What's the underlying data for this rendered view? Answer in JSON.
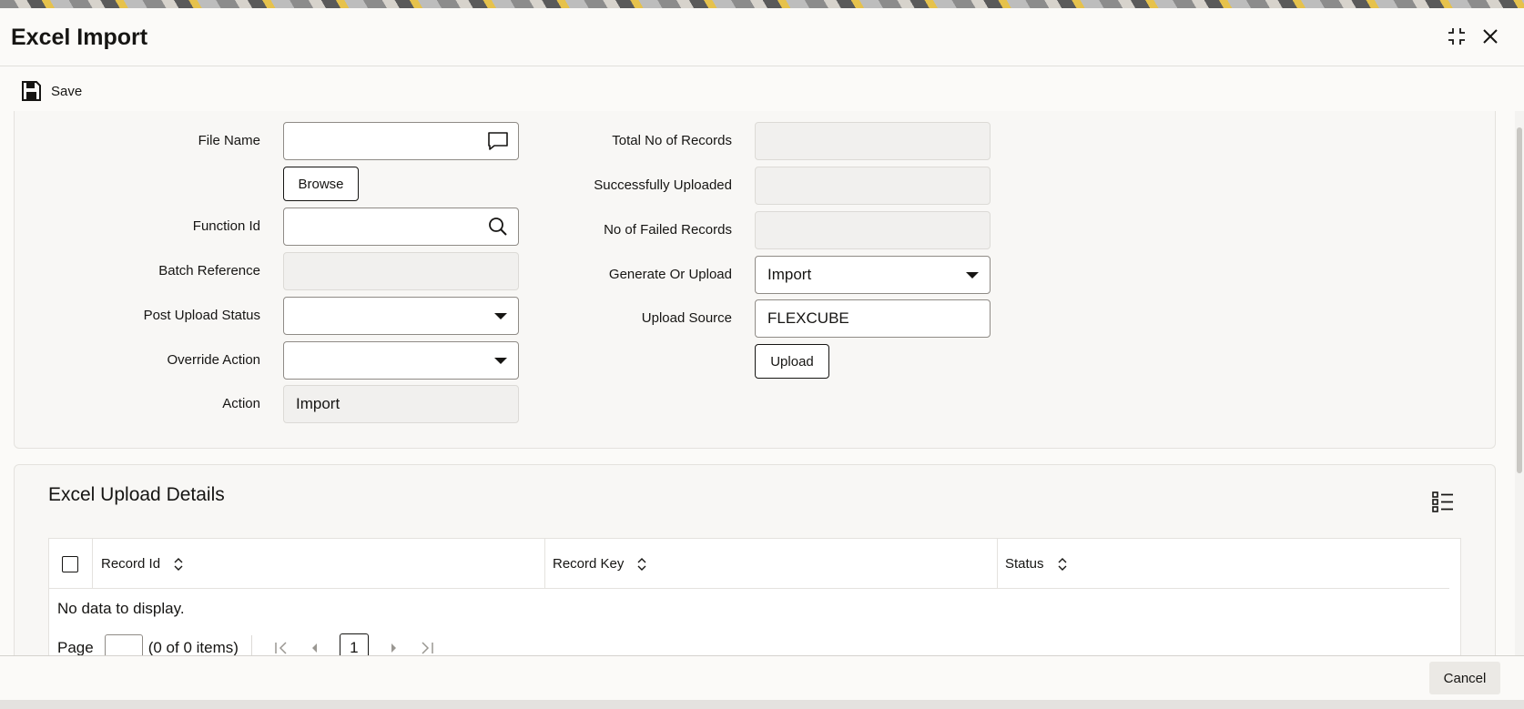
{
  "window": {
    "title": "Excel Import"
  },
  "toolbar": {
    "save_label": "Save"
  },
  "form": {
    "file_name": {
      "label": "File Name",
      "value": ""
    },
    "browse_label": "Browse",
    "function_id": {
      "label": "Function Id",
      "value": ""
    },
    "batch_reference": {
      "label": "Batch Reference",
      "value": ""
    },
    "post_upload_status": {
      "label": "Post Upload Status",
      "value": ""
    },
    "override_action": {
      "label": "Override Action",
      "value": ""
    },
    "action": {
      "label": "Action",
      "value": "Import"
    },
    "total_records": {
      "label": "Total No of Records",
      "value": ""
    },
    "successfully_uploaded": {
      "label": "Successfully Uploaded",
      "value": ""
    },
    "failed_records": {
      "label": "No of Failed Records",
      "value": ""
    },
    "generate_or_upload": {
      "label": "Generate Or Upload",
      "value": "Import"
    },
    "upload_source": {
      "label": "Upload Source",
      "value": "FLEXCUBE"
    },
    "upload_label": "Upload"
  },
  "details": {
    "title": "Excel Upload Details",
    "columns": [
      "Record Id",
      "Record Key",
      "Status"
    ],
    "empty_text": "No data to display.",
    "pager": {
      "page_label": "Page",
      "page_input": "",
      "items_text": "(0 of 0 items)",
      "current_page": "1"
    }
  },
  "footer": {
    "cancel_label": "Cancel"
  },
  "icons": {
    "save": "save-icon",
    "maximize": "maximize-icon",
    "close": "close-icon",
    "chat": "message-icon",
    "search": "search-icon",
    "list": "list-view-icon",
    "sort": "sort-icon",
    "first": "first-page-icon",
    "prev": "previous-page-icon",
    "next": "next-page-icon",
    "last": "last-page-icon"
  },
  "colors": {
    "text": "#161513",
    "border": "#8f8b86",
    "panel": "#f8f7f5"
  }
}
